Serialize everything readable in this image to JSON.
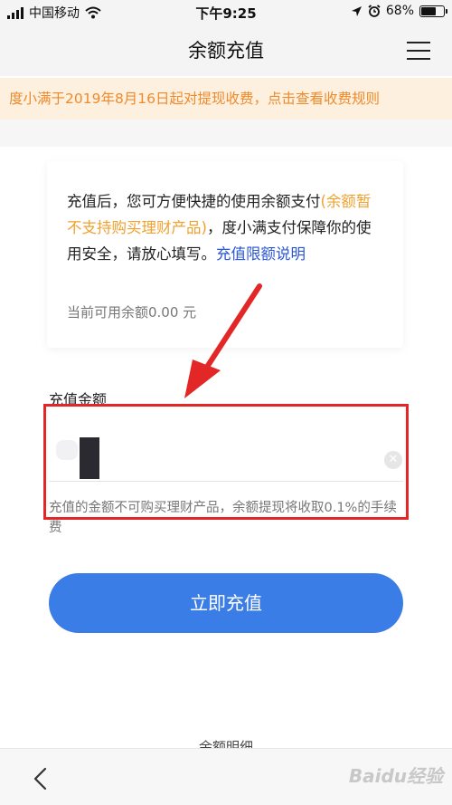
{
  "status_bar": {
    "carrier": "中国移动",
    "time": "下午9:25",
    "battery": "68%",
    "battery_level": 0.68
  },
  "nav": {
    "title": "余额充值",
    "menu_icon": "list-icon"
  },
  "notice": {
    "text": "度小满于2019年8月16日起对提现收费，点击查看收费规则"
  },
  "info_card": {
    "text_1": "充值后，您可方便快捷的使用余额支付",
    "text_orange": "(余额暂不支持购买理财产品)",
    "text_2": "，度小满支付保障你的使用安全，请放心填写。",
    "link": "充值限额说明",
    "balance": "当前可用余额0.00 元"
  },
  "amount": {
    "label": "充值金额",
    "note": "充值的金额不可购买理财产品，余额提现将收取0.1%的手续费",
    "clear_icon": "close-circle-icon"
  },
  "submit": {
    "label": "立即充值"
  },
  "detail_link": "余额明细",
  "bottom": {
    "back_icon": "chevron-left-icon",
    "watermark": "Baidu经验"
  },
  "colors": {
    "accent": "#3b7de6",
    "notice_text": "#f08a2b",
    "notice_bg": "#fdf0df",
    "link": "#2a56d6",
    "highlight": "#e32626"
  }
}
